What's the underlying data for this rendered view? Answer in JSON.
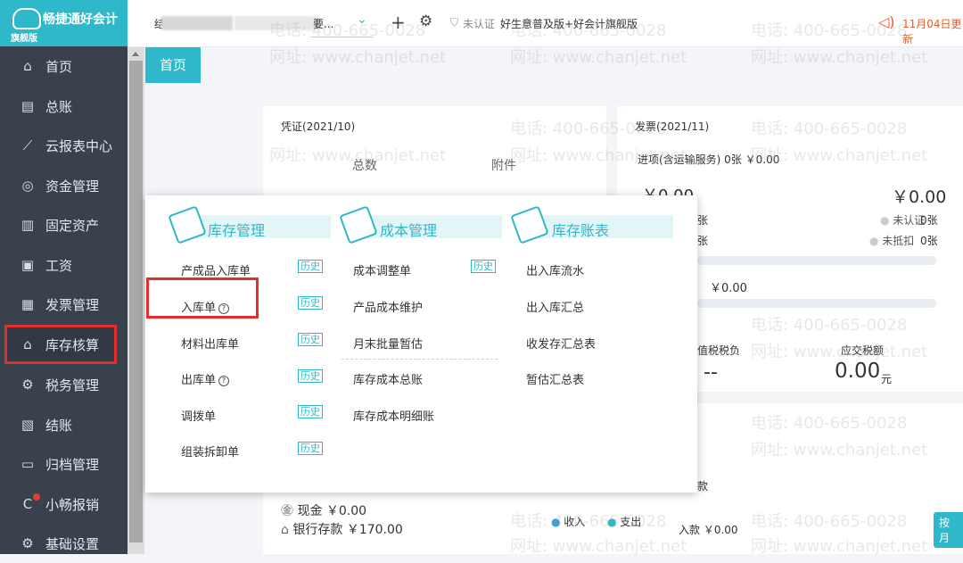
{
  "app": {
    "title": "畅捷通好会计",
    "edition": "旗舰版"
  },
  "sidebar": {
    "items": [
      {
        "label": "首页",
        "icon": "home-icon"
      },
      {
        "label": "总账",
        "icon": "ledger-icon"
      },
      {
        "label": "云报表中心",
        "icon": "chart-icon"
      },
      {
        "label": "资金管理",
        "icon": "money-icon"
      },
      {
        "label": "固定资产",
        "icon": "asset-icon"
      },
      {
        "label": "工资",
        "icon": "salary-icon"
      },
      {
        "label": "发票管理",
        "icon": "invoice-icon"
      },
      {
        "label": "库存核算",
        "icon": "warehouse-icon"
      },
      {
        "label": "税务管理",
        "icon": "tax-icon"
      },
      {
        "label": "结账",
        "icon": "checkout-icon"
      },
      {
        "label": "归档管理",
        "icon": "archive-icon"
      },
      {
        "label": "小畅报销",
        "icon": "reimburse-icon"
      },
      {
        "label": "基础设置",
        "icon": "settings-icon"
      }
    ]
  },
  "topbar": {
    "company_prefix": "结",
    "company_suffix": "要...",
    "auth_status": "未认证",
    "product": "好生意普及版+好会计旗舰版",
    "date_notice": "11月04日更新"
  },
  "tabs": {
    "home": "首页"
  },
  "voucher": {
    "title": "凭证(2021/10)",
    "total_label": "总数",
    "attach_label": "附件"
  },
  "invoice": {
    "title": "发票(2021/11)",
    "inbound": "进项(含运输服务) 0张 ￥0.00",
    "amount_left": "￥0.00",
    "amount_right": "￥0.00",
    "unverified_label": "未认证",
    "unverified_count": "0张",
    "undeducted_label": "未抵扣",
    "undeducted_count": "0张",
    "zhang1": "张",
    "zhang2": "张",
    "bar_amount": "￥0.00",
    "vat_label": "值税税负",
    "vat_value": "--",
    "payable_label": "应交税额",
    "payable_value": "0.00",
    "payable_unit": "元"
  },
  "funds": {
    "cash": "现金 ￥0.00",
    "bank": "银行存款 ￥170.00",
    "income": "收入",
    "expense": "支出",
    "receivable": "入款 ￥0.00",
    "cut_label": "款",
    "month_btn": "按月"
  },
  "popup": {
    "inventory_mgmt": {
      "title": "库存管理",
      "items": [
        "产成品入库单",
        "入库单",
        "材料出库单",
        "出库单",
        "调拨单",
        "组装拆卸单"
      ]
    },
    "cost_mgmt": {
      "title": "成本管理",
      "items": [
        "成本调整单",
        "产品成本维护",
        "月末批量暂估",
        "库存成本总账",
        "库存成本明细账"
      ]
    },
    "inventory_reports": {
      "title": "库存账表",
      "items": [
        "出入库流水",
        "出入库汇总",
        "收发存汇总表",
        "暂估汇总表"
      ]
    },
    "history_label": "历史"
  },
  "watermark": {
    "phone": "电话: 400-665-0028",
    "site": "网址: www.chanjet.net"
  },
  "colors": {
    "accent": "#2fb8c9",
    "sidebar": "#39414d",
    "highlight": "#e42d2d"
  }
}
